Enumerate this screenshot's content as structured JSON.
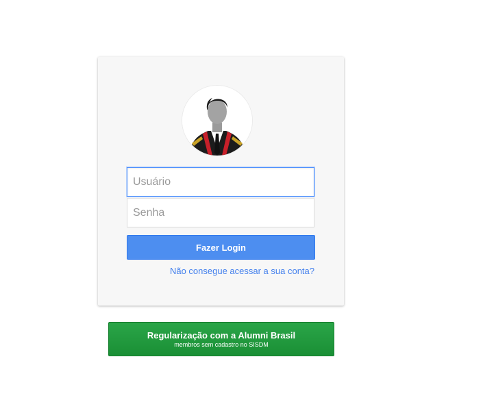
{
  "login": {
    "username_placeholder": "Usuário",
    "password_placeholder": "Senha",
    "submit_label": "Fazer Login",
    "help_link": "Não consegue acessar a sua conta?"
  },
  "alumni": {
    "title": "Regularização com a Alumni Brasil",
    "subtitle": "membros sem cadastro no SISDM"
  },
  "colors": {
    "primary_button": "#4d8ef0",
    "link": "#427fed",
    "alumni_button": "#1f9a3d",
    "card_background": "#f7f7f7"
  },
  "icons": {
    "avatar": "profile-avatar-uniform"
  }
}
